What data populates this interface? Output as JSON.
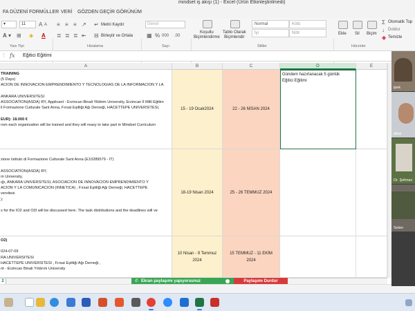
{
  "window": {
    "title": "mindset iş akışı (1) - Excel (Ürün Etkinleştirilmedi)"
  },
  "ribbon": {
    "tabs": [
      "FA DÜZENİ",
      "FORMÜLLER",
      "VERİ",
      "GÖZDEN GEÇİR",
      "GÖRÜNÜM"
    ],
    "font_size": "11",
    "wrap_text": "Metni Kaydır",
    "merge_center": "Birleştir ve Ortala",
    "number_format": "Genel",
    "cond_format": "Koşullu\nBiçimlendirme",
    "format_table": "Tablo Olarak\nBiçimlendir",
    "styles": [
      "Normal",
      "Kötü",
      "İyi",
      "Nötr"
    ],
    "insert": "Ekle",
    "delete": "Sil",
    "format": "Biçim",
    "autosum": "Otomatik Top",
    "fill": "Doldur",
    "clear": "Temizle",
    "groups": {
      "font": "Yazı Tipi",
      "alignment": "Hizalama",
      "number": "Sayı",
      "styles": "Stiller",
      "cells": "Hücreler"
    }
  },
  "formula_bar": {
    "fx": "fx",
    "value": "Eğitici Eğitimi"
  },
  "columns": [
    "A",
    "B",
    "C",
    "D",
    "E"
  ],
  "rows": [
    {
      "a_lines": [
        "TRAINING",
        "(5 Days)",
        "ACION DE INNOVACION EMPRENDIMIENTO Y TECNOLOGIAS DE LA INFORMACION Y LA",
        "",
        "ANKARA UNIVERSITESI",
        "ASSOCIATION(ASDA) RY, Applicant - Erzincan Binali Yildirim University, Erzincan İl Milli Eğitim",
        "li Formazione Culturale Sant Anna, Fırsat Eşitliği Ağı Derneği, HACETTEPE UNIVERSITESI,",
        "",
        "EUR): 18.000 €",
        "rom each organization will be trained and they will reasy to take part in Mindset Curriculum"
      ],
      "b": "15 - 19 Ocak2024",
      "c": "22 - 26  NİSAN 2024",
      "d": "Gündem hazırlanacak 5 günlük\nEğitici Eğitimi"
    },
    {
      "a_lines": [
        "",
        "zione Istituto di Formazione Culturale Sant Anna (E10289579 - IT)",
        "",
        "ASSOCIATION(ASDA) RY,",
        "m University,",
        "ığı, ANKARA UNIVERSITESI, ASOCIACION DE INNOVACION EMPRENDIMIENTO Y",
        "ACION Y LA COMUNICACION (INNETICA) , Fırsat Eşitliği Ağı Derneği, HACETTEPE",
        "versitesi",
        "):",
        "",
        "s for the IO2 and OI3 will be discussed here. The task distributions and the deadlines will ve"
      ],
      "b": "18-19 Nisan 2024",
      "c": "25 - 26 TEMMUZ 2024",
      "d": ""
    },
    {
      "a_lines": [
        "O2)",
        "",
        "024-07-09",
        "RA UNIVERSITESI",
        "HACETTEPE UNIVERSITESI , Fırsat Eşitliği Ağı Derneği ,",
        "nt - Erzincan Binali Yıldırım University"
      ],
      "b": "10 Nisan - 9 Temmuz\n2024",
      "c": "15 TEMMUZ - 11 EKİM\n2024",
      "d": ""
    }
  ],
  "sheet_tab": "2",
  "screen_share": {
    "sharing": "Ekran paylaşımı yapıyorsunuz",
    "stop": "Paylaşımı Durdur"
  },
  "participants": [
    {
      "name": "ipek"
    },
    {
      "name": "dilek"
    },
    {
      "name": "Dr. Şehnaz"
    },
    {
      "name": "Selen"
    }
  ],
  "taskbar_icons": [
    "start-icon",
    "search-icon",
    "file-explorer-icon",
    "edge-icon",
    "photos-icon",
    "word-icon",
    "powerpoint-icon",
    "office-icon",
    "game-icon",
    "chrome-icon",
    "zoom-icon",
    "mail-icon",
    "excel-icon",
    "pdf-icon"
  ]
}
